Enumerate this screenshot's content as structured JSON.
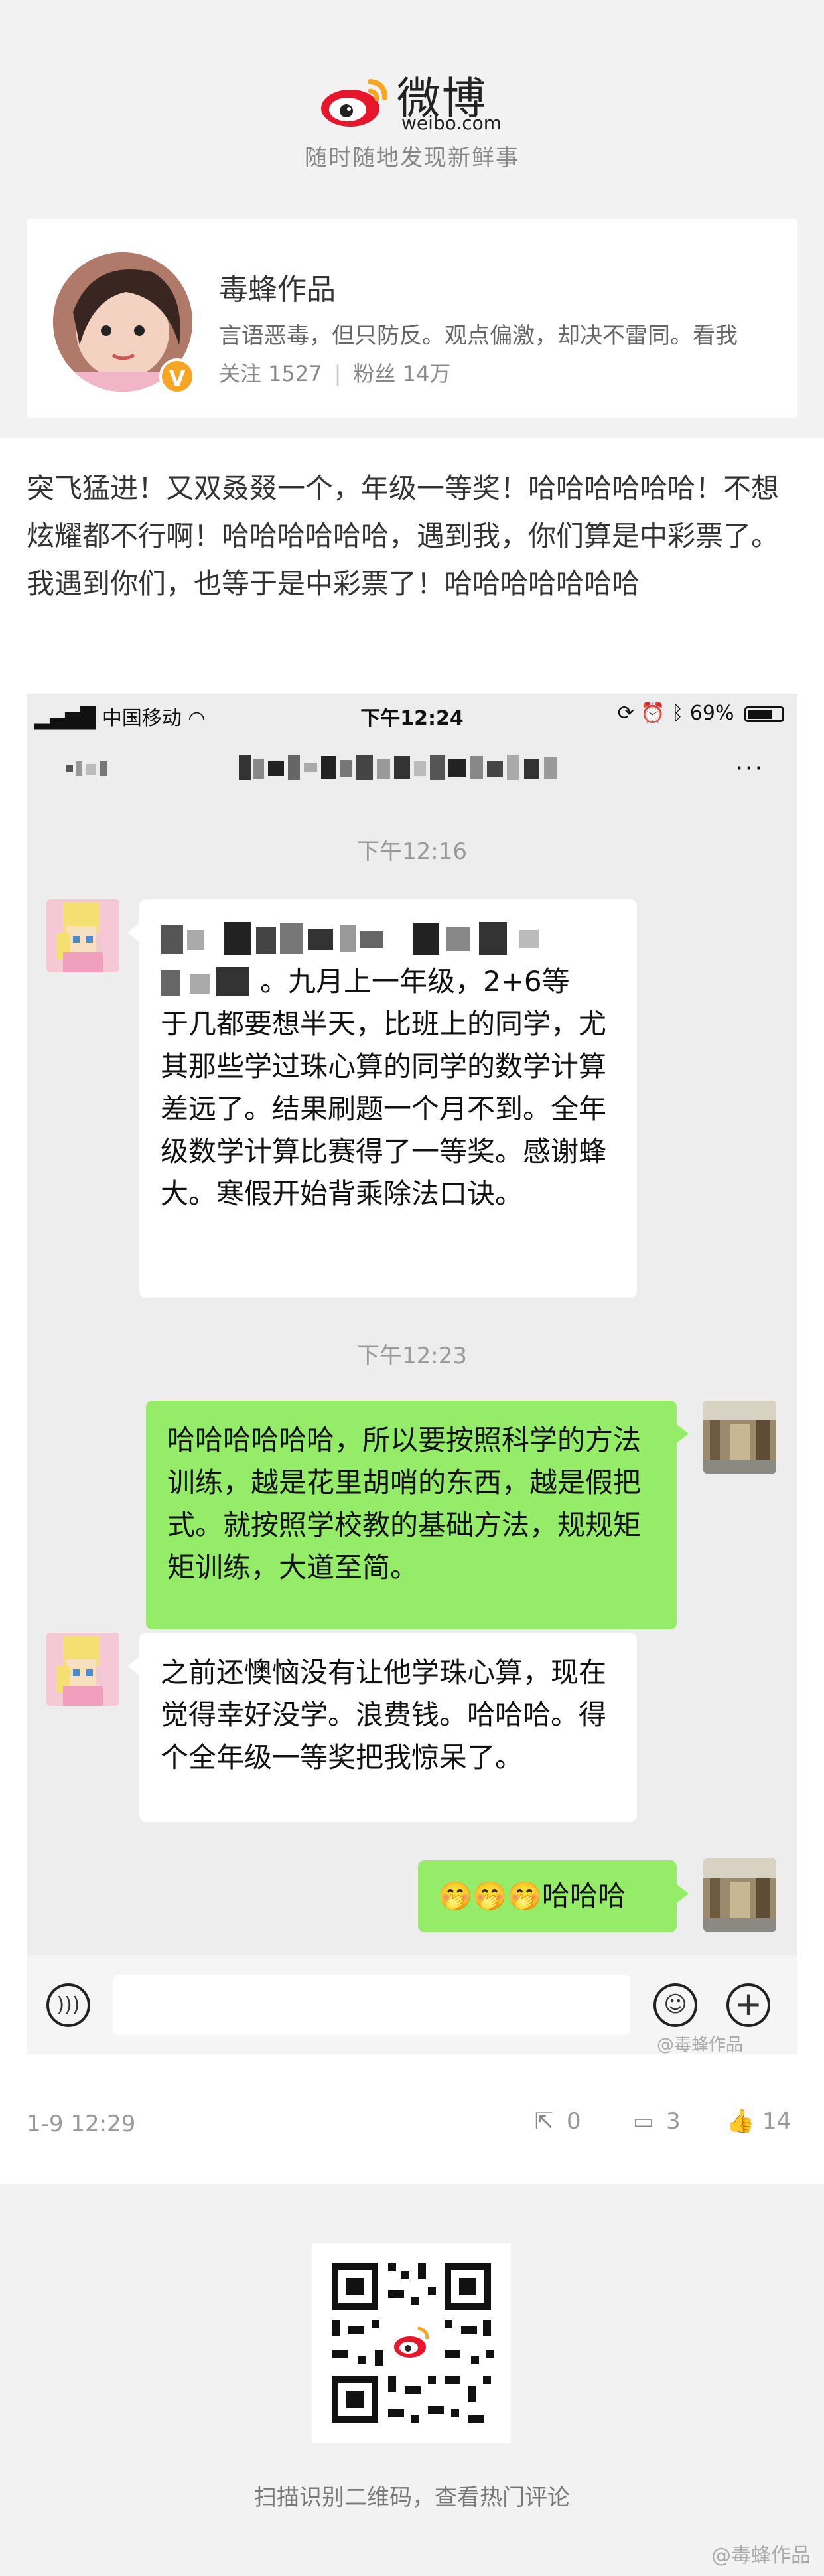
{
  "header": {
    "logo_text": "微博",
    "logo_sub": "weibo.com",
    "slogan": "随时随地发现新鲜事"
  },
  "profile": {
    "name": "毒蜂作品",
    "bio": "言语恶毒，但只防反。观点偏激，却决不雷同。看我",
    "following_label": "关注 1527",
    "followers_label": "粉丝 14万",
    "verified_badge": "V"
  },
  "post": {
    "text": "突飞猛进！又双叒叕一个，年级一等奖！哈哈哈哈哈哈！不想炫耀都不行啊！哈哈哈哈哈哈，遇到我，你们算是中彩票了。我遇到你们，也等于是中彩票了！哈哈哈哈哈哈哈",
    "date": "1-9 12:29",
    "reposts": "0",
    "comments": "3",
    "likes": "14"
  },
  "phone": {
    "carrier": "中国移动",
    "time": "下午12:24",
    "battery": "69%",
    "more": "···",
    "messages": [
      {
        "timestamp": "下午12:16"
      },
      {
        "side": "in",
        "text": "。九月上一年级，2+6等于几都要想半天，比班上的同学，尤其那些学过珠心算的同学的数学计算差远了。结果刷题一个月不到。全年级数学计算比赛得了一等奖。感谢蜂大。寒假开始背乘除法口诀。"
      },
      {
        "timestamp": "下午12:23"
      },
      {
        "side": "out",
        "text": "哈哈哈哈哈哈，所以要按照科学的方法训练，越是花里胡哨的东西，越是假把式。就按照学校教的基础方法，规规矩矩训练，大道至简。"
      },
      {
        "side": "in",
        "text": "之前还懊恼没有让他学珠心算，现在觉得幸好没学。浪费钱。哈哈哈。得个全年级一等奖把我惊呆了。"
      },
      {
        "side": "out",
        "text": "🤭🤭🤭哈哈哈"
      }
    ],
    "inner_watermark": "@毒蜂作品"
  },
  "qr": {
    "caption": "扫描识别二维码，查看热门评论"
  },
  "bottom_watermark": "@毒蜂作品",
  "colors": {
    "bubble_out": "#95ec69",
    "bubble_in": "#ffffff",
    "chat_bg": "#ededed",
    "brand_red": "#e6162d",
    "verified": "#f6a623"
  }
}
